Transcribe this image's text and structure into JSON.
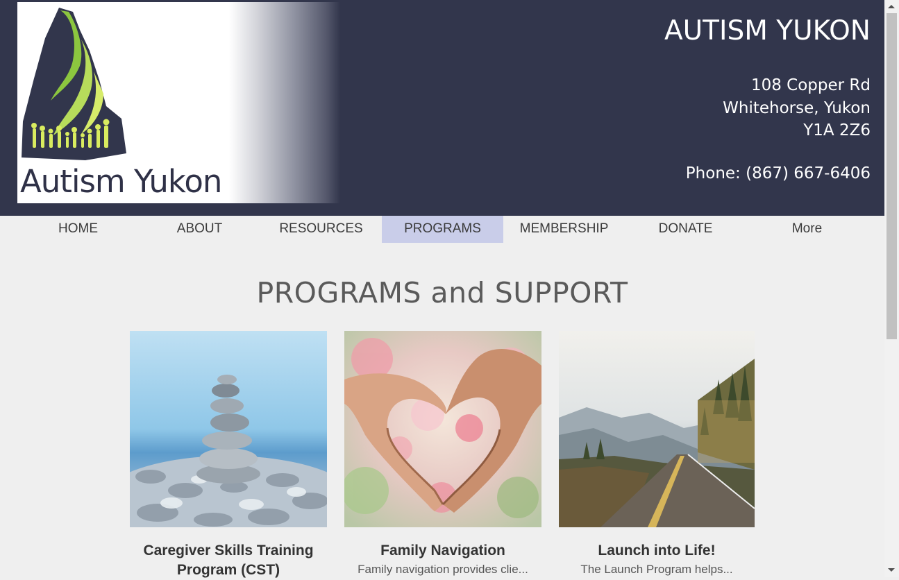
{
  "header": {
    "logo_text": "Autism Yukon",
    "site_title": "AUTISM YUKON",
    "address": [
      "108 Copper Rd",
      "Whitehorse, Yukon",
      "Y1A 2Z6"
    ],
    "phone": "Phone: (867) 667-6406"
  },
  "nav": {
    "items": [
      "HOME",
      "ABOUT",
      "RESOURCES",
      "PROGRAMS",
      "MEMBERSHIP",
      "DONATE",
      "More"
    ],
    "active": "PROGRAMS",
    "active_color": "#c9cde9"
  },
  "main": {
    "title": "PROGRAMS and SUPPORT",
    "cards": [
      {
        "title": "Caregiver Skills Training Program (CST)",
        "desc": "",
        "image": "stacked-stones-image"
      },
      {
        "title": "Family Navigation",
        "desc": "Family navigation provides clie...",
        "image": "heart-hands-image"
      },
      {
        "title": "Launch into Life!",
        "desc": "The Launch Program helps...",
        "image": "mountain-road-image"
      }
    ]
  },
  "colors": {
    "header_bg": "#32364c",
    "page_bg": "#efefef",
    "logo_green": "#8cc63f"
  }
}
